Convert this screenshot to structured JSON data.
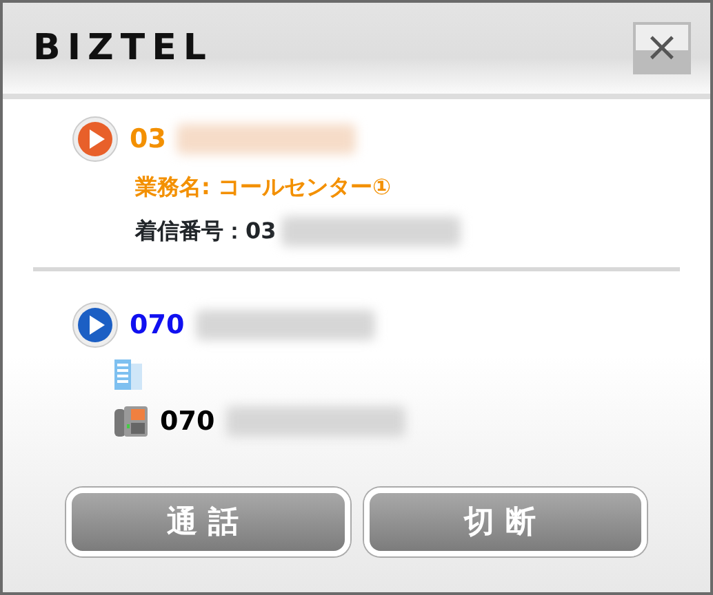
{
  "window": {
    "title": "BIZTEL",
    "close": "×"
  },
  "calls": [
    {
      "kind": "incoming",
      "color": "#e8602a",
      "number": "03",
      "lines": [
        {
          "kind": "business",
          "text": "業務名: コールセンター①"
        },
        {
          "kind": "caller",
          "text": "着信番号：03"
        }
      ]
    },
    {
      "kind": "outgoing",
      "color": "#1c5fc4",
      "number": "070",
      "lines": [
        {
          "kind": "building"
        },
        {
          "kind": "phone",
          "text": "070"
        }
      ]
    }
  ],
  "buttons": [
    "通話",
    "切断"
  ]
}
